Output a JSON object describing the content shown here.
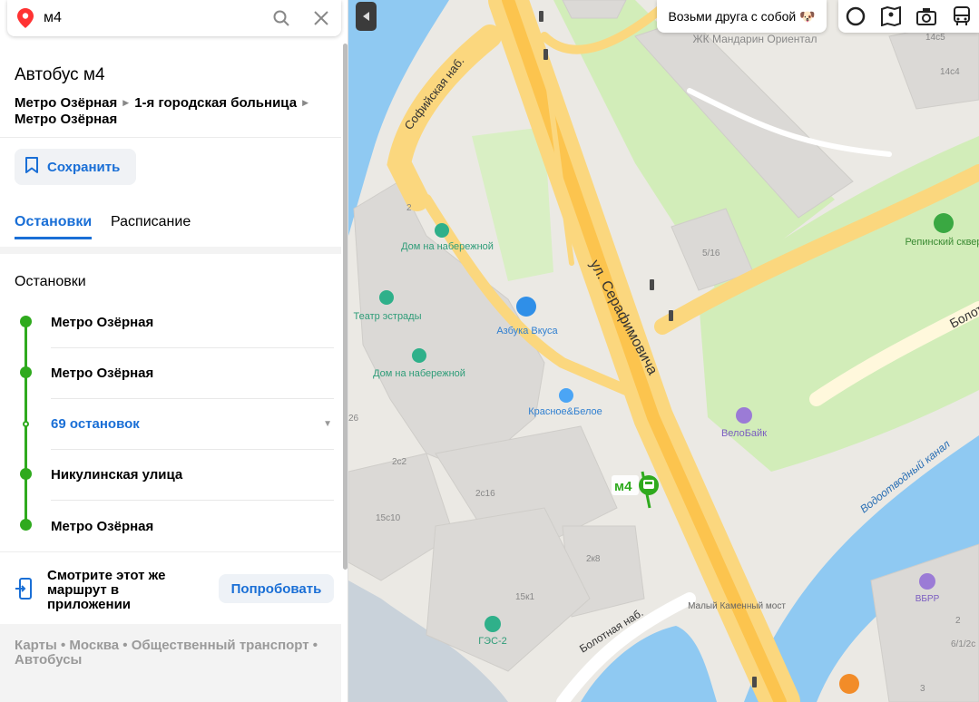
{
  "search": {
    "value": "м4"
  },
  "route": {
    "title": "Автобус м4",
    "from": "Метро Озёрная",
    "via": "1-я городская больница",
    "to": "Метро Озёрная"
  },
  "actions": {
    "save_label": "Сохранить"
  },
  "tabs": [
    {
      "label": "Остановки",
      "active": true
    },
    {
      "label": "Расписание",
      "active": false
    }
  ],
  "stops": {
    "heading": "Остановки",
    "items": [
      {
        "label": "Метро Озёрная"
      },
      {
        "label": "Метро Озёрная"
      },
      {
        "label": "69 остановок"
      },
      {
        "label": "Никулинская улица"
      },
      {
        "label": "Метро Озёрная"
      }
    ]
  },
  "promo": {
    "text": "Смотрите этот же маршрут в приложении",
    "button": "Попробовать"
  },
  "breadcrumbs": {
    "items": [
      "Карты",
      "Москва",
      "Общественный транспорт",
      "Автобусы"
    ],
    "separator": "•"
  },
  "map": {
    "chip": "Возьми друга с собой",
    "chip_emoji": "🐶",
    "bus_label": "м4",
    "streets": {
      "serafimovicha": "ул. Серафимовича",
      "sofiyskaya": "Софийская наб.",
      "bolotnaya_nab": "Болотная наб.",
      "bolotnaya_right": "Болот",
      "canal": "Водоотводный канал"
    },
    "pois": {
      "mandarin": "ЖК Мандарин Ориентал",
      "dom_top": "Дом на набережной",
      "dom_mid": "Дом на набережной",
      "teatr": "Театр эстрады",
      "azbuka": "Азбука Вкуса",
      "krasnoe": "Красное&Белое",
      "repinsky": "Репинский сквер",
      "velobike": "ВелоБайк",
      "most": "Малый Каменный мост",
      "ges": "ГЭС-2",
      "vbrr": "ВБРР"
    },
    "houses": [
      "14с5",
      "14с4",
      "5/16",
      "2",
      "26",
      "2с2",
      "2с16",
      "15с10",
      "2к8",
      "15к1",
      "2",
      "6/1/2с",
      "3"
    ],
    "colors": {
      "route": "#2faa1e",
      "accent": "#1a6fd6",
      "road": "#fbd77e",
      "park": "#d2edb9",
      "water": "#8fc9f2"
    }
  },
  "icons": [
    "location-pin-icon",
    "search-icon",
    "close-icon",
    "bookmark-icon",
    "phone-icon",
    "collapse-arrow-icon",
    "alice-icon",
    "panorama-icon",
    "camera-icon",
    "transport-icon",
    "bus-icon"
  ]
}
